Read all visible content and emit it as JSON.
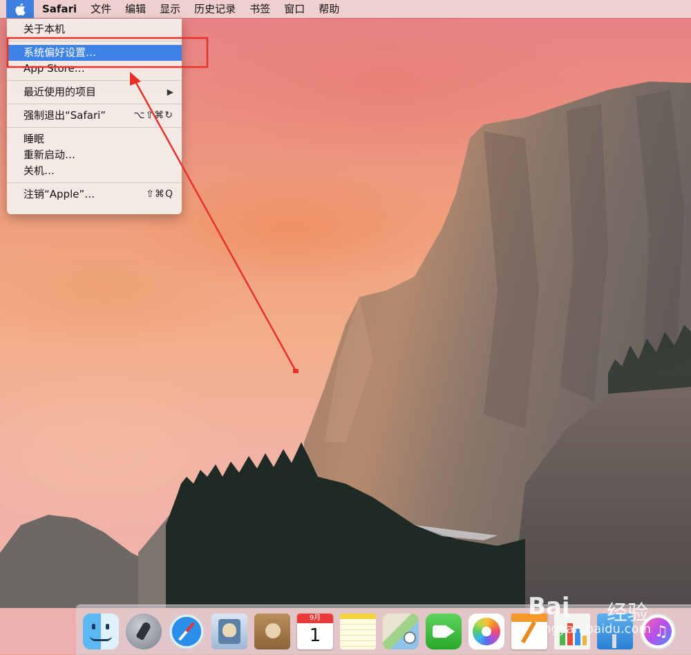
{
  "menubar": {
    "app_name": "Safari",
    "items": [
      "文件",
      "编辑",
      "显示",
      "历史记录",
      "书签",
      "窗口",
      "帮助"
    ]
  },
  "apple_menu": {
    "about": "关于本机",
    "system_preferences": "系统偏好设置…",
    "app_store": "App Store…",
    "recent_items": "最近使用的项目",
    "recent_items_arrow": "▶",
    "force_quit": "强制退出“Safari”",
    "force_quit_shortcut": "⌥⇧⌘↻",
    "sleep": "睡眠",
    "restart": "重新启动…",
    "shutdown": "关机…",
    "logout": "注销“Apple”…",
    "logout_shortcut": "⇧⌘Q"
  },
  "dock": {
    "calendar_month": "9月",
    "calendar_day": "1",
    "icons": [
      "finder-icon",
      "launchpad-icon",
      "safari-icon",
      "mail-icon",
      "contacts-icon",
      "calendar-icon",
      "notes-icon",
      "maps-icon",
      "facetime-icon",
      "photos-icon",
      "pages-icon",
      "numbers-icon",
      "keynote-icon",
      "itunes-icon"
    ]
  },
  "watermark": {
    "brand": "Bai",
    "brand_suffix": "经验",
    "url": "jingyan.baidu.com"
  },
  "colors": {
    "highlight": "#3d82e6",
    "annotation": "#e8302a"
  }
}
